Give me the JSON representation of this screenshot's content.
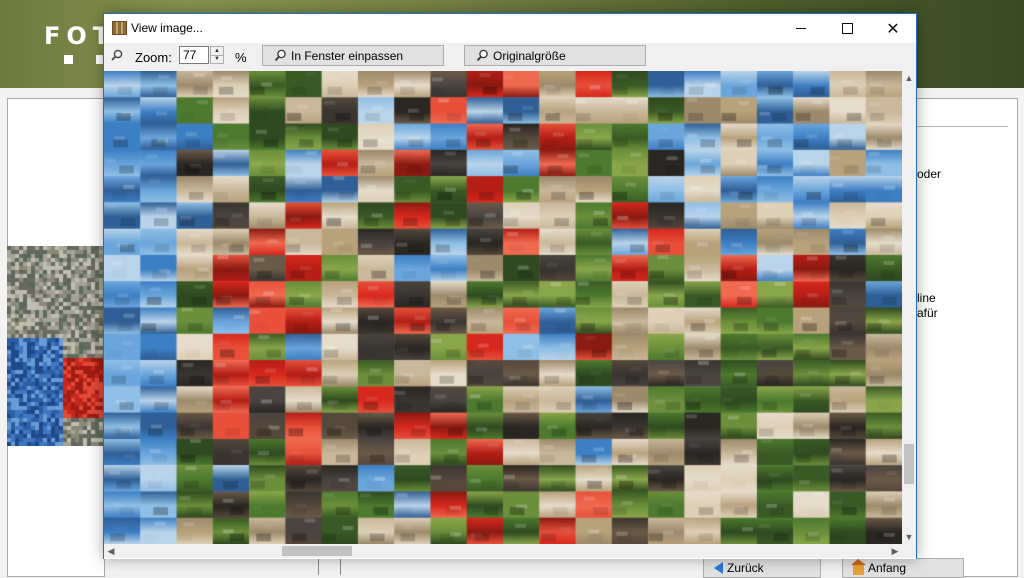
{
  "background_app": {
    "banner_title": "FOT",
    "right_text_1": "oder",
    "right_text_2": "line",
    "right_text_3": "afür",
    "back_button": "Zurück",
    "start_button": "Anfang"
  },
  "dialog": {
    "title": "View image...",
    "zoom_label": "Zoom:",
    "zoom_value": "77",
    "percent_label": "%",
    "fit_button": "In Fenster einpassen",
    "original_button": "Originalgröße",
    "image": {
      "description_icon": "photo-mosaic",
      "tile_columns": 22,
      "tile_rows": 18
    }
  },
  "colors": {
    "accent": "#1f6fc0",
    "banner": "#7a8446",
    "button_face": "#e1e1e1"
  }
}
